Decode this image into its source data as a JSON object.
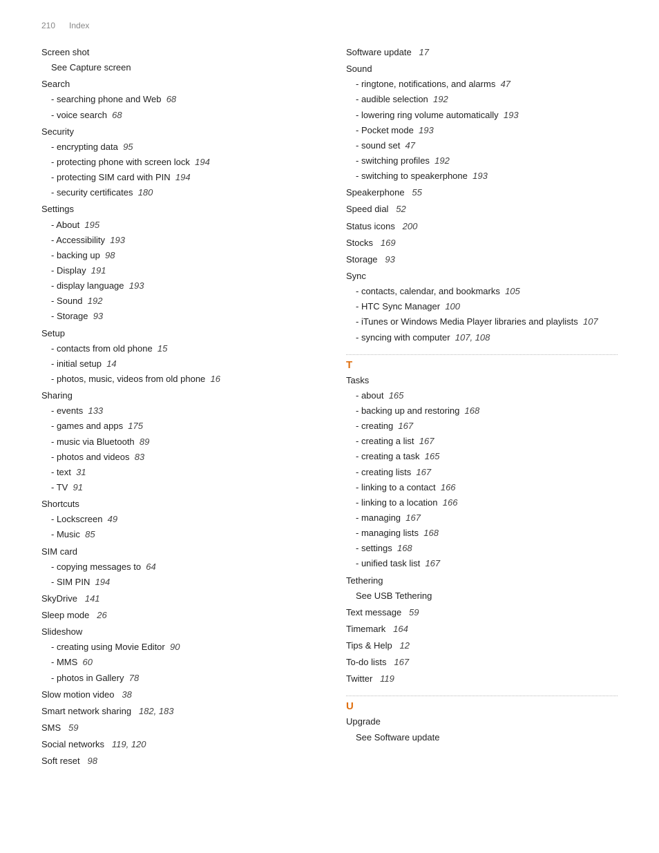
{
  "header": {
    "page_num": "210",
    "section": "Index"
  },
  "left_col": [
    {
      "type": "main",
      "text": "Screen shot"
    },
    {
      "type": "sub_noref",
      "text": "See Capture screen"
    },
    {
      "type": "main",
      "text": "Search"
    },
    {
      "type": "sub",
      "text": "- searching phone and Web",
      "ref": "68"
    },
    {
      "type": "sub",
      "text": "- voice search",
      "ref": "68"
    },
    {
      "type": "main",
      "text": "Security"
    },
    {
      "type": "sub",
      "text": "- encrypting data",
      "ref": "95"
    },
    {
      "type": "sub_wrap",
      "text": "- protecting phone with screen     lock",
      "ref": "194"
    },
    {
      "type": "sub",
      "text": "- protecting SIM card with PIN",
      "ref": "194"
    },
    {
      "type": "sub",
      "text": "- security certificates",
      "ref": "180"
    },
    {
      "type": "main",
      "text": "Settings"
    },
    {
      "type": "sub",
      "text": "- About",
      "ref": "195"
    },
    {
      "type": "sub",
      "text": "- Accessibility",
      "ref": "193"
    },
    {
      "type": "sub",
      "text": "- backing up",
      "ref": "98"
    },
    {
      "type": "sub",
      "text": "- Display",
      "ref": "191"
    },
    {
      "type": "sub",
      "text": "- display language",
      "ref": "193"
    },
    {
      "type": "sub",
      "text": "- Sound",
      "ref": "192"
    },
    {
      "type": "sub",
      "text": "- Storage",
      "ref": "93"
    },
    {
      "type": "main",
      "text": "Setup"
    },
    {
      "type": "sub",
      "text": "- contacts from old phone",
      "ref": "15"
    },
    {
      "type": "sub",
      "text": "- initial setup",
      "ref": "14"
    },
    {
      "type": "sub_wrap2",
      "text": "- photos, music, videos from old      phone",
      "ref": "16"
    },
    {
      "type": "main",
      "text": "Sharing"
    },
    {
      "type": "sub",
      "text": "- events",
      "ref": "133"
    },
    {
      "type": "sub",
      "text": "- games and apps",
      "ref": "175"
    },
    {
      "type": "sub",
      "text": "- music via Bluetooth",
      "ref": "89"
    },
    {
      "type": "sub",
      "text": "- photos and videos",
      "ref": "83"
    },
    {
      "type": "sub",
      "text": "- text",
      "ref": "31"
    },
    {
      "type": "sub",
      "text": "- TV",
      "ref": "91"
    },
    {
      "type": "main",
      "text": "Shortcuts"
    },
    {
      "type": "sub",
      "text": "- Lockscreen",
      "ref": "49"
    },
    {
      "type": "sub",
      "text": "- Music",
      "ref": "85"
    },
    {
      "type": "main",
      "text": "SIM card"
    },
    {
      "type": "sub",
      "text": "- copying messages to",
      "ref": "64"
    },
    {
      "type": "sub",
      "text": "- SIM PIN",
      "ref": "194"
    },
    {
      "type": "main_ref",
      "text": "SkyDrive",
      "ref": "141"
    },
    {
      "type": "main_ref",
      "text": "Sleep mode",
      "ref": "26"
    },
    {
      "type": "main",
      "text": "Slideshow"
    },
    {
      "type": "sub",
      "text": "- creating using Movie Editor",
      "ref": "90"
    },
    {
      "type": "sub",
      "text": "- MMS",
      "ref": "60"
    },
    {
      "type": "sub",
      "text": "- photos in Gallery",
      "ref": "78"
    },
    {
      "type": "main_ref",
      "text": "Slow motion video",
      "ref": "38"
    },
    {
      "type": "main_ref",
      "text": "Smart network sharing",
      "ref": "182, 183"
    },
    {
      "type": "main_ref",
      "text": "SMS",
      "ref": "59"
    },
    {
      "type": "main_ref",
      "text": "Social networks",
      "ref": "119, 120"
    },
    {
      "type": "main_ref",
      "text": "Soft reset",
      "ref": "98"
    }
  ],
  "right_col": [
    {
      "type": "main_ref",
      "text": "Software update",
      "ref": "17"
    },
    {
      "type": "main",
      "text": "Sound"
    },
    {
      "type": "sub",
      "text": "- ringtone, notifications, and alarms",
      "ref": "47"
    },
    {
      "type": "sub",
      "text": "- audible selection",
      "ref": "192"
    },
    {
      "type": "sub_wrap2",
      "text": "- lowering ring volume       automatically",
      "ref": "193"
    },
    {
      "type": "sub",
      "text": "- Pocket mode",
      "ref": "193"
    },
    {
      "type": "sub",
      "text": "- sound set",
      "ref": "47"
    },
    {
      "type": "sub",
      "text": "- switching profiles",
      "ref": "192"
    },
    {
      "type": "sub",
      "text": "- switching to speakerphone",
      "ref": "193"
    },
    {
      "type": "main_ref",
      "text": "Speakerphone",
      "ref": "55"
    },
    {
      "type": "main_ref",
      "text": "Speed dial",
      "ref": "52"
    },
    {
      "type": "main_ref",
      "text": "Status icons",
      "ref": "200"
    },
    {
      "type": "main_ref",
      "text": "Stocks",
      "ref": "169"
    },
    {
      "type": "main_ref",
      "text": "Storage",
      "ref": "93"
    },
    {
      "type": "main",
      "text": "Sync"
    },
    {
      "type": "sub_wrap2",
      "text": "- contacts, calendar, and      bookmarks",
      "ref": "105"
    },
    {
      "type": "sub",
      "text": "- HTC Sync Manager",
      "ref": "100"
    },
    {
      "type": "sub_wrap2",
      "text": "- iTunes or Windows Media Player      libraries and playlists",
      "ref": "107"
    },
    {
      "type": "sub",
      "text": "- syncing with computer",
      "ref": "107, 108"
    },
    {
      "type": "section_letter",
      "text": "T"
    },
    {
      "type": "main",
      "text": "Tasks"
    },
    {
      "type": "sub",
      "text": "- about",
      "ref": "165"
    },
    {
      "type": "sub",
      "text": "- backing up and restoring",
      "ref": "168"
    },
    {
      "type": "sub",
      "text": "- creating",
      "ref": "167"
    },
    {
      "type": "sub",
      "text": "- creating a list",
      "ref": "167"
    },
    {
      "type": "sub",
      "text": "- creating a task",
      "ref": "165"
    },
    {
      "type": "sub",
      "text": "- creating lists",
      "ref": "167"
    },
    {
      "type": "sub",
      "text": "- linking to a contact",
      "ref": "166"
    },
    {
      "type": "sub",
      "text": "- linking to a location",
      "ref": "166"
    },
    {
      "type": "sub",
      "text": "- managing",
      "ref": "167"
    },
    {
      "type": "sub",
      "text": "- managing lists",
      "ref": "168"
    },
    {
      "type": "sub",
      "text": "- settings",
      "ref": "168"
    },
    {
      "type": "sub",
      "text": "- unified task list",
      "ref": "167"
    },
    {
      "type": "main",
      "text": "Tethering"
    },
    {
      "type": "sub_noref",
      "text": "See USB Tethering"
    },
    {
      "type": "main_ref",
      "text": "Text message",
      "ref": "59"
    },
    {
      "type": "main_ref",
      "text": "Timemark",
      "ref": "164"
    },
    {
      "type": "main_ref",
      "text": "Tips & Help",
      "ref": "12"
    },
    {
      "type": "main_ref",
      "text": "To-do lists",
      "ref": "167"
    },
    {
      "type": "main_ref",
      "text": "Twitter",
      "ref": "119"
    },
    {
      "type": "section_letter",
      "text": "U"
    },
    {
      "type": "main",
      "text": "Upgrade"
    },
    {
      "type": "sub_noref",
      "text": "See Software update"
    }
  ]
}
